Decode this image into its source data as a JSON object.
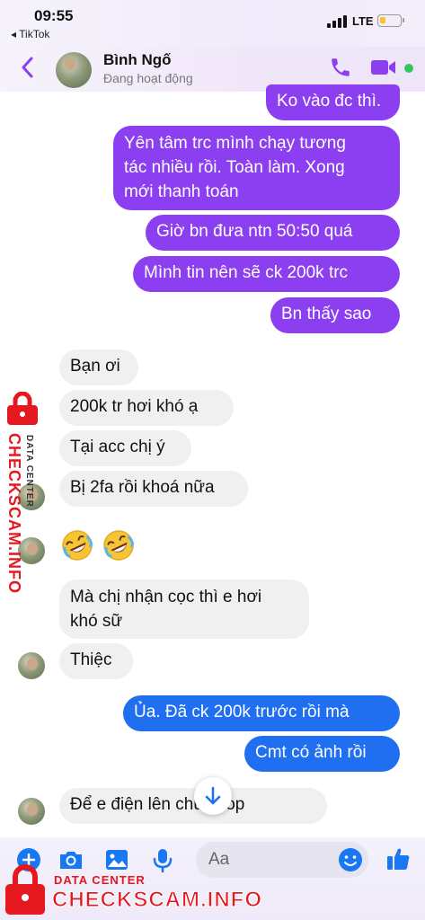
{
  "status_bar": {
    "time": "09:55",
    "back_to_app": "◂ TikTok",
    "network": "LTE",
    "battery_level": 0.3
  },
  "header": {
    "contact_name": "Bình Ngố",
    "contact_status": "Đang hoạt động",
    "accent_color": "#8b3ff0",
    "active_color": "#31c95c"
  },
  "messages": [
    {
      "from": "me",
      "text": "Ko vào đc thì."
    },
    {
      "from": "me",
      "text": "Yên tâm trc mình chạy tương\ntác nhiều rồi. Toàn làm. Xong\nmới thanh toán"
    },
    {
      "from": "me",
      "text": "Giờ bn đưa ntn 50:50 quá"
    },
    {
      "from": "me",
      "text": "Mình tin nên sẽ ck 200k trc"
    },
    {
      "from": "me",
      "text": "Bn thấy sao"
    },
    {
      "from": "them",
      "text": "Bạn ơi"
    },
    {
      "from": "them",
      "text": "200k tr hơi khó ạ"
    },
    {
      "from": "them",
      "text": "Tại acc chị ý"
    },
    {
      "from": "them",
      "text": "Bị 2fa rồi khoá nữa"
    },
    {
      "from": "them",
      "text": "🤣🤣",
      "type": "emoji",
      "icon": "rolling-on-floor-laughing-icon"
    },
    {
      "from": "them",
      "text": "Mà chị nhận cọc thì e hơi\nkhó sữ"
    },
    {
      "from": "them",
      "text": "Thiệc"
    },
    {
      "from": "me",
      "text": "Ủa. Đã ck 200k trước rồi mà"
    },
    {
      "from": "me",
      "text": "Cmt có ảnh rồi"
    },
    {
      "from": "them",
      "text": "Để e điện lên chủ shop",
      "partially_hidden_by": "scroll-down-button"
    }
  ],
  "composer": {
    "placeholder": "Aa",
    "icons": [
      "plus-icon",
      "camera-icon",
      "gallery-icon",
      "microphone-icon",
      "emoji-icon",
      "thumbs-up-icon"
    ]
  },
  "colors": {
    "outgoing_purple": "#8b3ff0",
    "outgoing_blue": "#1f6ff0",
    "incoming": "#f0f0f0",
    "messenger_blue": "#1877f2",
    "watermark_red": "#e5171f"
  },
  "watermark": {
    "side_brand": "CHECKSCAM.INFO",
    "side_tag": "DATA CENTER",
    "bottom_tag": "DATA CENTER",
    "bottom_brand": "CHECKSCAM.INFO"
  }
}
